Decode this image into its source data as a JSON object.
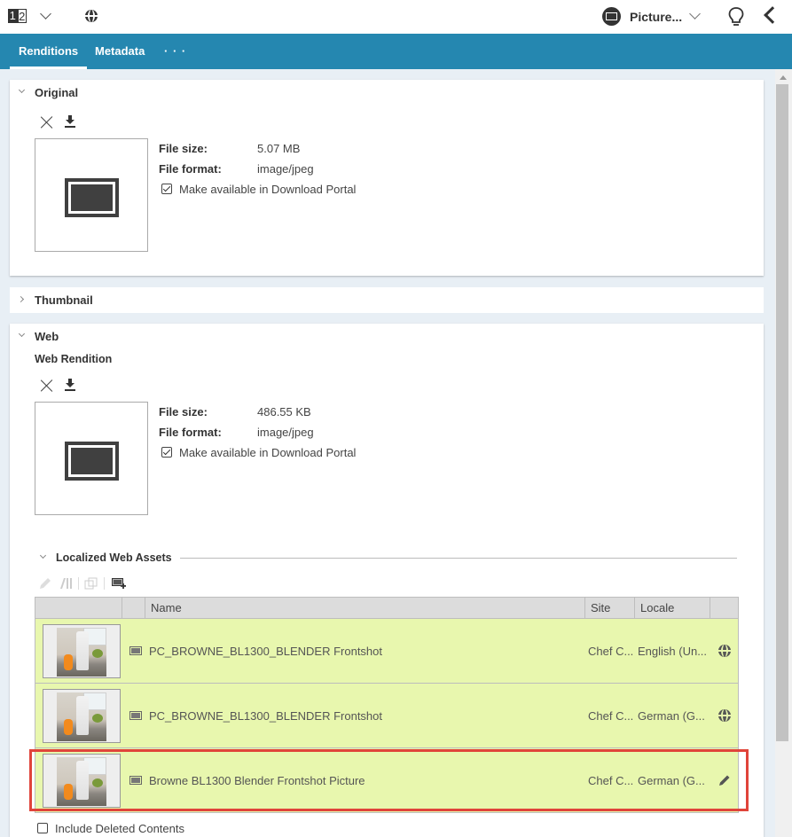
{
  "topbar": {
    "page_badge": [
      "1",
      "2"
    ],
    "picture_label": "Picture...",
    "icons": [
      "page-layout-icon",
      "chevron-down-icon",
      "globe-icon",
      "picture-type-icon",
      "chevron-down-icon",
      "lightbulb-icon",
      "back-chevron-icon"
    ]
  },
  "tabs": [
    {
      "label": "Renditions",
      "active": true
    },
    {
      "label": "Metadata",
      "active": false
    },
    {
      "label": "· · ·",
      "active": false
    }
  ],
  "sections": {
    "original": {
      "title": "Original",
      "expanded": true,
      "file_size_label": "File size:",
      "file_size": "5.07 MB",
      "file_format_label": "File format:",
      "file_format": "image/jpeg",
      "download_portal_label": "Make available in Download Portal",
      "download_portal_checked": true
    },
    "thumbnail": {
      "title": "Thumbnail",
      "expanded": false
    },
    "web": {
      "title": "Web",
      "expanded": true,
      "subtitle": "Web Rendition",
      "file_size_label": "File size:",
      "file_size": "486.55 KB",
      "file_format_label": "File format:",
      "file_format": "image/jpeg",
      "download_portal_label": "Make available in Download Portal",
      "download_portal_checked": true
    }
  },
  "localized": {
    "title": "Localized Web Assets",
    "toolbar": [
      "edit-icon",
      "compare-icon",
      "copy-icon",
      "create-picture-icon"
    ],
    "columns": [
      "",
      "",
      "Name",
      "Site",
      "Locale",
      ""
    ],
    "rows": [
      {
        "name": "PC_BROWNE_BL1300_BLENDER Frontshot",
        "site": "Chef C...",
        "locale": "English (Un...",
        "action_icon": "globe-icon"
      },
      {
        "name": "PC_BROWNE_BL1300_BLENDER Frontshot",
        "site": "Chef C...",
        "locale": "German (G...",
        "action_icon": "globe-icon"
      },
      {
        "name": "Browne BL1300 Blender Frontshot Picture",
        "site": "Chef C...",
        "locale": "German (G...",
        "action_icon": "pencil-icon",
        "highlighted": true
      }
    ],
    "include_deleted_label": "Include Deleted Contents",
    "include_deleted_checked": false
  },
  "colors": {
    "tab_bar": "#2587b0",
    "row_bg": "#e8f7ae",
    "highlight": "#e0443a"
  }
}
